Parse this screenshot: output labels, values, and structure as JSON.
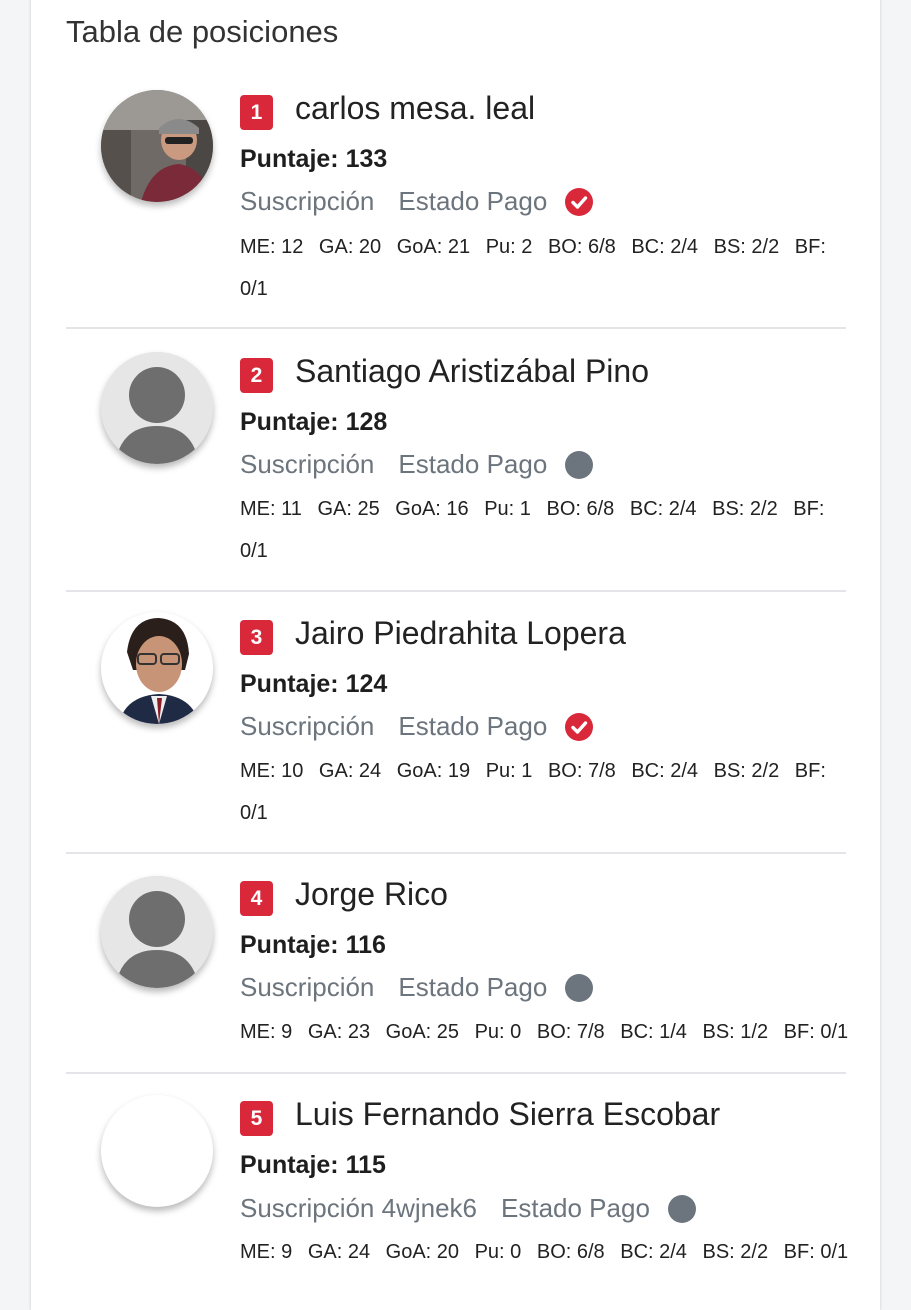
{
  "title": "Tabla de posiciones",
  "colors": {
    "accent": "#d8283a",
    "muted": "#6c757d"
  },
  "rows": [
    {
      "rank": "1",
      "name": "carlos mesa. leal",
      "score": "Puntaje: 133",
      "subscription": "Suscripción",
      "payment_label": "Estado Pago",
      "payment_status": "check-circle-icon",
      "stats": [
        "ME: 12",
        "GA: 20",
        "GoA: 21",
        "Pu: 2",
        "BO: 6/8",
        "BC: 2/4",
        "BS: 2/2",
        "BF: 0/1"
      ]
    },
    {
      "rank": "2",
      "name": "Santiago Aristizábal Pino",
      "score": "Puntaje: 128",
      "subscription": "Suscripción",
      "payment_label": "Estado Pago",
      "payment_status": "circle-icon",
      "stats": [
        "ME: 11",
        "GA: 25",
        "GoA: 16",
        "Pu: 1",
        "BO: 6/8",
        "BC: 2/4",
        "BS: 2/2",
        "BF: 0/1"
      ]
    },
    {
      "rank": "3",
      "name": "Jairo Piedrahita Lopera",
      "score": "Puntaje: 124",
      "subscription": "Suscripción",
      "payment_label": "Estado Pago",
      "payment_status": "check-circle-icon",
      "stats": [
        "ME: 10",
        "GA: 24",
        "GoA: 19",
        "Pu: 1",
        "BO: 7/8",
        "BC: 2/4",
        "BS: 2/2",
        "BF: 0/1"
      ]
    },
    {
      "rank": "4",
      "name": "Jorge Rico",
      "score": "Puntaje: 116",
      "subscription": "Suscripción",
      "payment_label": "Estado Pago",
      "payment_status": "circle-icon",
      "stats": [
        "ME: 9",
        "GA: 23",
        "GoA: 25",
        "Pu: 0",
        "BO: 7/8",
        "BC: 1/4",
        "BS: 1/2",
        "BF: 0/1"
      ]
    },
    {
      "rank": "5",
      "name": "Luis Fernando Sierra Escobar",
      "score": "Puntaje: 115",
      "subscription": "Suscripción 4wjnek6",
      "payment_label": "Estado Pago",
      "payment_status": "circle-icon",
      "stats": [
        "ME: 9",
        "GA: 24",
        "GoA: 20",
        "Pu: 0",
        "BO: 6/8",
        "BC: 2/4",
        "BS: 2/2",
        "BF: 0/1"
      ]
    }
  ]
}
